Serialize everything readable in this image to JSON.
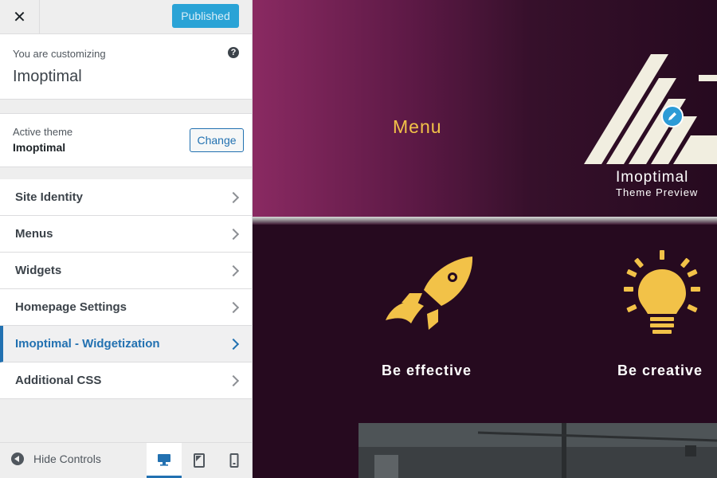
{
  "sidebar": {
    "close_label": "✕",
    "publish_label": "Published",
    "customizing": {
      "label": "You are customizing",
      "site_name": "Imoptimal",
      "help_glyph": "?"
    },
    "theme": {
      "label": "Active theme",
      "name": "Imoptimal",
      "change_label": "Change"
    },
    "items": [
      {
        "label": "Site Identity",
        "active": false
      },
      {
        "label": "Menus",
        "active": false
      },
      {
        "label": "Widgets",
        "active": false
      },
      {
        "label": "Homepage Settings",
        "active": false
      },
      {
        "label": "Imoptimal - Widgetization",
        "active": true
      },
      {
        "label": "Additional CSS",
        "active": false
      }
    ],
    "footer": {
      "hide_label": "Hide Controls",
      "devices": [
        {
          "icon": "desktop-icon",
          "active": true
        },
        {
          "icon": "tablet-icon",
          "active": false
        },
        {
          "icon": "mobile-icon",
          "active": false
        }
      ]
    }
  },
  "preview": {
    "menu_label": "Menu",
    "site_title": "Imoptimal",
    "site_description": "Theme Preview",
    "features": [
      {
        "icon": "rocket-icon",
        "label": "Be effective"
      },
      {
        "icon": "lightbulb-icon",
        "label": "Be creative"
      }
    ]
  },
  "colors": {
    "accent": "#2271b1",
    "publish": "#2aa3d6",
    "hero_gradient_start": "#8a2a62",
    "preview_bg": "#260a1f",
    "icon_yellow": "#f2c248",
    "logo_cream": "#f1eee0"
  }
}
